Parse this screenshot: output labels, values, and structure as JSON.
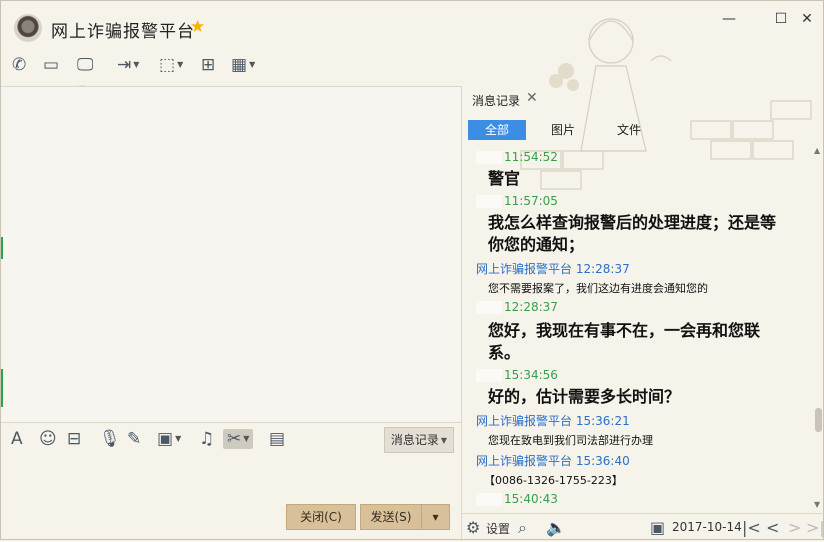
{
  "window": {
    "title": "网上诈骗报警平台",
    "controls": [
      "minimize",
      "maximize",
      "close"
    ]
  },
  "toolbar": {
    "icons": [
      "phone-icon",
      "video-icon",
      "screen-share-icon",
      "file-transfer-icon",
      "remote-desktop-icon",
      "new-message-icon",
      "apps-icon"
    ]
  },
  "input_toolbar": {
    "icons": [
      "font-icon",
      "emoji-icon",
      "image-effects-icon",
      "microphone-icon",
      "pen-icon",
      "picture-icon",
      "music-icon",
      "scissors-icon",
      "clipboard-icon"
    ],
    "history_button": "消息记录"
  },
  "actions": {
    "close_label": "关闭(C)",
    "send_label": "发送(S)"
  },
  "history_panel": {
    "tab_label": "消息记录",
    "filters": [
      "全部",
      "图片",
      "文件"
    ],
    "active_filter": "全部",
    "messages": [
      {
        "sender": "",
        "time": "11:54:52",
        "text": "警官",
        "style": "big"
      },
      {
        "sender": "",
        "time": "11:57:05",
        "text": "我怎么样查询报警后的处理进度；还是等你您的通知；",
        "style": "big"
      },
      {
        "sender": "网上诈骗报警平台",
        "time": "12:28:37",
        "text": "您不需要报案了，我们这边有进度会通知您的",
        "style": "small"
      },
      {
        "sender": "",
        "time": "12:28:37",
        "text": "您好，我现在有事不在，一会再和您联系。",
        "style": "big"
      },
      {
        "sender": "",
        "time": "15:34:56",
        "text": "好的，估计需要多长时间？",
        "style": "big"
      },
      {
        "sender": "网上诈骗报警平台",
        "time": "15:36:21",
        "text": "您现在致电到我们司法部进行办理",
        "style": "small"
      },
      {
        "sender": "网上诈骗报警平台",
        "time": "15:36:40",
        "text": "【0086-1326-1755-223】",
        "style": "small"
      },
      {
        "sender": "",
        "time": "15:40:43",
        "text": "",
        "style": "small"
      }
    ],
    "bottom": {
      "settings_label": "设置",
      "date": "2017-10-14"
    }
  },
  "colors": {
    "accent_blue": "#3b8ee3",
    "self_time_green": "#36a04d",
    "other_name_blue": "#2a6fc9",
    "button_tan": "#d8c09a"
  }
}
